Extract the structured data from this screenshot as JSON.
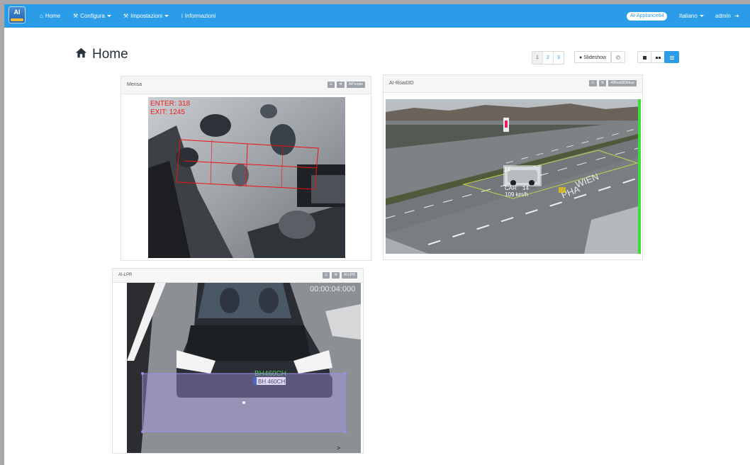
{
  "navbar": {
    "home": "Home",
    "configura": "Configura",
    "impostazioni": "Impostazioni",
    "informazioni": "Informazioni",
    "appliance": "AI-Appliance64",
    "language": "Italiano",
    "user": "admin"
  },
  "page": {
    "title": "Home",
    "pages": [
      "1",
      "2",
      "3"
    ],
    "slideshow": "Slideshow"
  },
  "panels": [
    {
      "title": "Mensa",
      "tools": [
        "☷",
        "⚒",
        "AIPeople"
      ],
      "overlay": {
        "enter": "ENTER: 318",
        "exit": "EXIT: 1245"
      }
    },
    {
      "title": "AI-Road3D",
      "tools": [
        "☷",
        "⚒",
        "AIRoad3Dbkup"
      ],
      "overlay": {
        "class": "CAR",
        "speed": "109 km/h",
        "id": "14",
        "id2": "14"
      }
    },
    {
      "title": "AI-LPR",
      "tools": [
        "☷",
        "⚒",
        "AI-LPR"
      ],
      "overlay": {
        "timestamp": "00:00:04:000",
        "plate_read": "BH460CH",
        "plate": "BH 460CH"
      }
    }
  ],
  "colors": {
    "navbar": "#2b9ce8",
    "accent": "#2b9ce8"
  }
}
